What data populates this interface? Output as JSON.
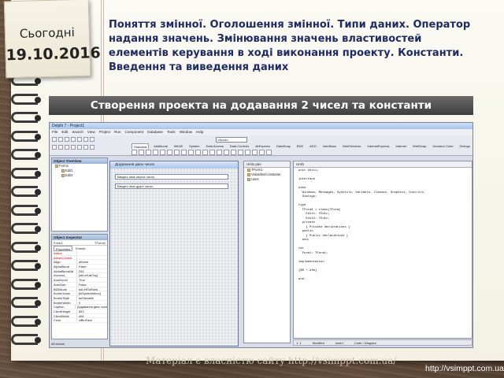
{
  "note": {
    "label": "Сьогодні",
    "date": "19.10.2016"
  },
  "heading": "Поняття змінної. Оголошення змінної. Типи даних. Оператор надання значень. Змінювання значень властивостей елементів керування в ході виконання проекту. Константи. Введення та виведення даних",
  "banner": "Створення проекта на додавання 2 чисел та константи",
  "footer_note": "Матеріал є власністю сайту http://vsimppt.com.ua/",
  "site_url": "http://vsimppt.com.ua/",
  "ide": {
    "title": "Delphi 7 - Project1",
    "menu": [
      "File",
      "Edit",
      "Search",
      "View",
      "Project",
      "Run",
      "Component",
      "Database",
      "Tools",
      "Window",
      "Help"
    ],
    "layout_combo": "<None>",
    "palette_tabs": [
      "Standard",
      "Additional",
      "Win32",
      "System",
      "Data Access",
      "Data Controls",
      "dbExpress",
      "DataSnap",
      "BDE",
      "ADO",
      "InterBase",
      "WebServices",
      "InternetExpress",
      "Internet",
      "WebSnap",
      "Decision Cube",
      "Dialogs",
      "Win 3.1"
    ],
    "tree_view": {
      "title": "Object TreeView",
      "items": [
        "Form1",
        "Edit1",
        "Edit2"
      ]
    },
    "inspector": {
      "title": "Object Inspector",
      "selected": "Form1",
      "selected_type": "TForm1",
      "tabs": [
        "Properties",
        "Events"
      ],
      "rows": [
        {
          "name": "Action",
          "value": ""
        },
        {
          "name": "ActiveControl",
          "value": ""
        },
        {
          "name": "Align",
          "value": "alNone"
        },
        {
          "name": "AlphaBlend",
          "value": "False"
        },
        {
          "name": "AlphaBlendVal",
          "value": "255"
        },
        {
          "name": "Anchors",
          "value": "[akLeft,akTop]"
        },
        {
          "name": "AutoScroll",
          "value": "True"
        },
        {
          "name": "AutoSize",
          "value": "False"
        },
        {
          "name": "BiDiMode",
          "value": "bdLeftToRight"
        },
        {
          "name": "BorderIcons",
          "value": "[biSystemMenu]"
        },
        {
          "name": "BorderStyle",
          "value": "bsSizeable"
        },
        {
          "name": "BorderWidth",
          "value": "0"
        },
        {
          "name": "Caption",
          "value": "Додавання двох чисел"
        },
        {
          "name": "ClientHeight",
          "value": "553"
        },
        {
          "name": "ClientWidth",
          "value": "406"
        },
        {
          "name": "Color",
          "value": "clBtnFace"
        }
      ],
      "status": "All shown"
    },
    "form": {
      "caption": "Додавання двох чисел",
      "edit1": "Введіть своє перше число",
      "edit2": "Введіть своє друге число"
    },
    "explorer": {
      "tab": "Unit1.pas",
      "items": [
        "TForm1",
        "Variables/Constants",
        "Uses"
      ]
    },
    "editor": {
      "tab": "Unit1",
      "code": "unit Unit1;\n\ninterface\n\nuses\n  Windows, Messages, SysUtils, Variants, Classes, Graphics, Controls,\n  Dialogs;\n\ntype\n  TForm1 = class(TForm)\n    Edit1: TEdit;\n    Edit2: TEdit;\n  private\n    { Private declarations }\n  public\n    { Public declarations }\n  end;\n\nvar\n  Form1: TForm1;\n\nimplementation\n\n{$R *.dfm}\n\nend.",
      "status": {
        "position": "1: 1",
        "modified": "Modified",
        "mode": "Insert",
        "view": "Code / Diagram"
      }
    }
  }
}
